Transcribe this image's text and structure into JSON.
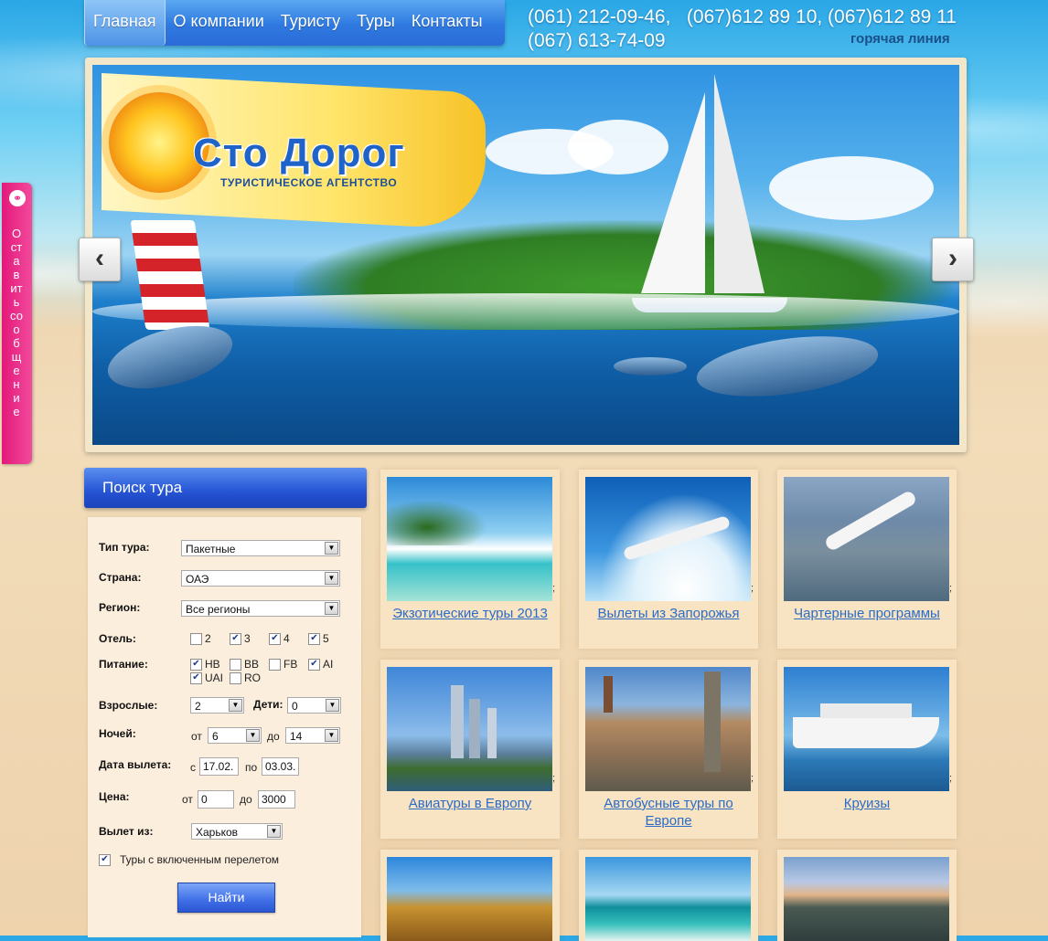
{
  "nav": {
    "items": [
      "Главная",
      "О компании",
      "Туристу",
      "Туры",
      "Контакты"
    ]
  },
  "contacts": {
    "phones_line1": "(061) 212-09-46,   (067)612 89 10, (067)612 89 11",
    "phones_line2": "(067) 613-74-09",
    "hotline": "горячая линия"
  },
  "banner": {
    "logo_title": "Сто Дорог",
    "logo_subtitle": "ТУРИСТИЧЕСКОЕ АГЕНТСТВО",
    "prev_icon": "chevron-left-icon",
    "next_icon": "chevron-right-icon"
  },
  "feedback": {
    "label": "Оставить сообщение",
    "icon": "chat-bubble-icon"
  },
  "search": {
    "title": "Поиск тура",
    "tour_type_label": "Тип тура:",
    "tour_type_value": "Пакетные",
    "country_label": "Страна:",
    "country_value": "ОАЭ",
    "region_label": "Регион:",
    "region_value": "Все регионы",
    "hotel_label": "Отель:",
    "hotel_options": [
      {
        "label": "2",
        "checked": false
      },
      {
        "label": "3",
        "checked": true
      },
      {
        "label": "4",
        "checked": true
      },
      {
        "label": "5",
        "checked": true
      }
    ],
    "meal_label": "Питание:",
    "meal_options": [
      {
        "label": "HB",
        "checked": true
      },
      {
        "label": "BB",
        "checked": false
      },
      {
        "label": "FB",
        "checked": false
      },
      {
        "label": "AI",
        "checked": true
      },
      {
        "label": "UAI",
        "checked": true
      },
      {
        "label": "RO",
        "checked": false
      }
    ],
    "adults_label": "Взрослые:",
    "adults_value": "2",
    "children_label": "Дети:",
    "children_value": "0",
    "nights_label": "Ночей:",
    "nights_from_label": "от",
    "nights_from_value": "6",
    "nights_to_label": "до",
    "nights_to_value": "14",
    "date_label": "Дата вылета:",
    "date_from_label": "с",
    "date_from_value": "17.02.",
    "date_to_label": "по",
    "date_to_value": "03.03.",
    "price_label": "Цена:",
    "price_from_label": "от",
    "price_from_value": "0",
    "price_to_label": "до",
    "price_to_value": "3000",
    "departure_label": "Вылет из:",
    "departure_value": "Харьков",
    "flight_included_label": "Туры с включенным перелетом",
    "flight_included_checked": true,
    "submit_label": "Найти"
  },
  "tours": [
    {
      "title": "Экзотические туры 2013",
      "suffix": ";"
    },
    {
      "title": "Вылеты из Запорожья",
      "suffix": ";"
    },
    {
      "title": "Чартерные программы",
      "suffix": ";"
    },
    {
      "title": "Авиатуры в Европу",
      "suffix": ";"
    },
    {
      "title": "Автобусные туры по Европе",
      "suffix": ";"
    },
    {
      "title": "Круизы",
      "suffix": ";"
    }
  ],
  "colors": {
    "nav_blue": "#2e79e0",
    "link_blue": "#2a6cc7",
    "feedback_pink": "#e3187b",
    "panel_bg": "#fbeedc"
  }
}
